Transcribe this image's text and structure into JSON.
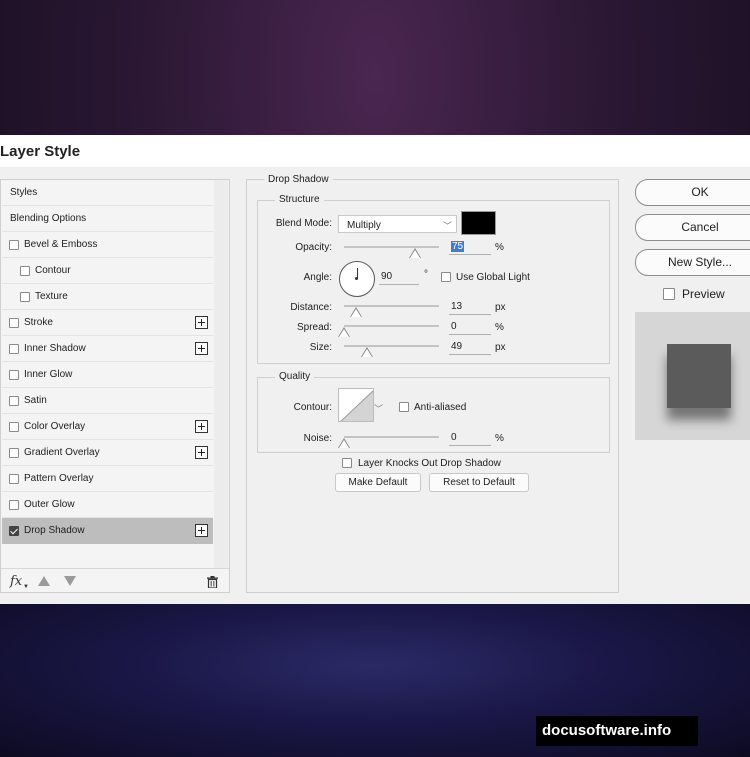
{
  "dialog": {
    "title": "Layer Style"
  },
  "style_list": {
    "items": [
      {
        "label": "Styles",
        "checkbox": false
      },
      {
        "label": "Blending Options",
        "checkbox": false
      },
      {
        "label": "Bevel & Emboss",
        "checkbox": true,
        "checked": false,
        "indent": false,
        "plus": false
      },
      {
        "label": "Contour",
        "checkbox": true,
        "checked": false,
        "indent": true,
        "plus": false
      },
      {
        "label": "Texture",
        "checkbox": true,
        "checked": false,
        "indent": true,
        "plus": false
      },
      {
        "label": "Stroke",
        "checkbox": true,
        "checked": false,
        "indent": false,
        "plus": true
      },
      {
        "label": "Inner Shadow",
        "checkbox": true,
        "checked": false,
        "indent": false,
        "plus": true
      },
      {
        "label": "Inner Glow",
        "checkbox": true,
        "checked": false,
        "indent": false,
        "plus": false
      },
      {
        "label": "Satin",
        "checkbox": true,
        "checked": false,
        "indent": false,
        "plus": false
      },
      {
        "label": "Color Overlay",
        "checkbox": true,
        "checked": false,
        "indent": false,
        "plus": true
      },
      {
        "label": "Gradient Overlay",
        "checkbox": true,
        "checked": false,
        "indent": false,
        "plus": true
      },
      {
        "label": "Pattern Overlay",
        "checkbox": true,
        "checked": false,
        "indent": false,
        "plus": false
      },
      {
        "label": "Outer Glow",
        "checkbox": true,
        "checked": false,
        "indent": false,
        "plus": false
      },
      {
        "label": "Drop Shadow",
        "checkbox": true,
        "checked": true,
        "indent": false,
        "plus": true,
        "selected": true
      }
    ],
    "footer": {
      "fx_label": "fx"
    }
  },
  "drop_shadow": {
    "section_title": "Drop Shadow",
    "structure": {
      "title": "Structure",
      "blend_mode_label": "Blend Mode:",
      "blend_mode_value": "Multiply",
      "shadow_color": "#000000",
      "opacity_label": "Opacity:",
      "opacity_value": "75",
      "opacity_unit": "%",
      "angle_label": "Angle:",
      "angle_value": "90",
      "angle_unit": "°",
      "use_global_light_label": "Use Global Light",
      "use_global_light_checked": false,
      "distance_label": "Distance:",
      "distance_value": "13",
      "distance_unit": "px",
      "spread_label": "Spread:",
      "spread_value": "0",
      "spread_unit": "%",
      "size_label": "Size:",
      "size_value": "49",
      "size_unit": "px"
    },
    "quality": {
      "title": "Quality",
      "contour_label": "Contour:",
      "anti_aliased_label": "Anti-aliased",
      "anti_aliased_checked": false,
      "noise_label": "Noise:",
      "noise_value": "0",
      "noise_unit": "%"
    },
    "knocks_out_label": "Layer Knocks Out Drop Shadow",
    "knocks_out_checked": true,
    "make_default_label": "Make Default",
    "reset_default_label": "Reset to Default"
  },
  "actions": {
    "ok_label": "OK",
    "cancel_label": "Cancel",
    "new_style_label": "New Style...",
    "preview_label": "Preview",
    "preview_checked": true
  },
  "watermark": "docusoftware.info"
}
